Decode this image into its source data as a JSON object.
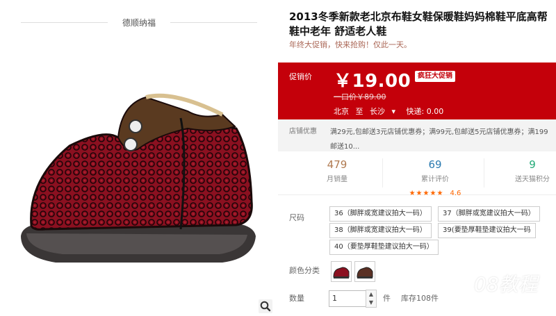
{
  "store": {
    "name": "德顺纳福"
  },
  "product": {
    "title": "2013冬季新款老北京布鞋女鞋保暖鞋妈妈棉鞋平底高帮鞋中老年 舒适老人鞋",
    "promo": "年终大促销，快来抢购！仅此一天。"
  },
  "price": {
    "label": "促销价",
    "value": "￥19.00",
    "badge": "疯狂大促销",
    "original": "一口价￥89.00",
    "ship_from": "北京",
    "ship_to_word": "至",
    "ship_to": "长沙",
    "express": "快递: 0.00"
  },
  "coupon": {
    "label": "店铺优惠",
    "text_line1": "满29元,包邮送3元店铺优惠券；满99元,包邮送5元店铺优惠券；满199",
    "text_line2": "邮送10..."
  },
  "stats": {
    "monthly_sales": "479",
    "monthly_sales_label": "月销量",
    "reviews": "69",
    "reviews_label": "累计评价",
    "rating": "4.6",
    "points": "9",
    "points_label": "送天猫积分"
  },
  "sku": {
    "size_label": "尺码",
    "sizes": [
      "36（脚胖或宽建议拍大一码）",
      "37（脚胖或宽建议拍大一码）",
      "38（脚胖或宽建议拍大一码）",
      "39(要垫厚鞋垫建议拍大一码",
      "40（要垫厚鞋垫建议拍大一码）"
    ],
    "color_label": "颜色分类",
    "qty_label": "数量",
    "qty_value": "1",
    "qty_unit": "件",
    "stock": "库存108件"
  },
  "watermark": "08教程",
  "colors": {
    "price_bg": "#c4000a",
    "stat_num": "#2a7"
  }
}
